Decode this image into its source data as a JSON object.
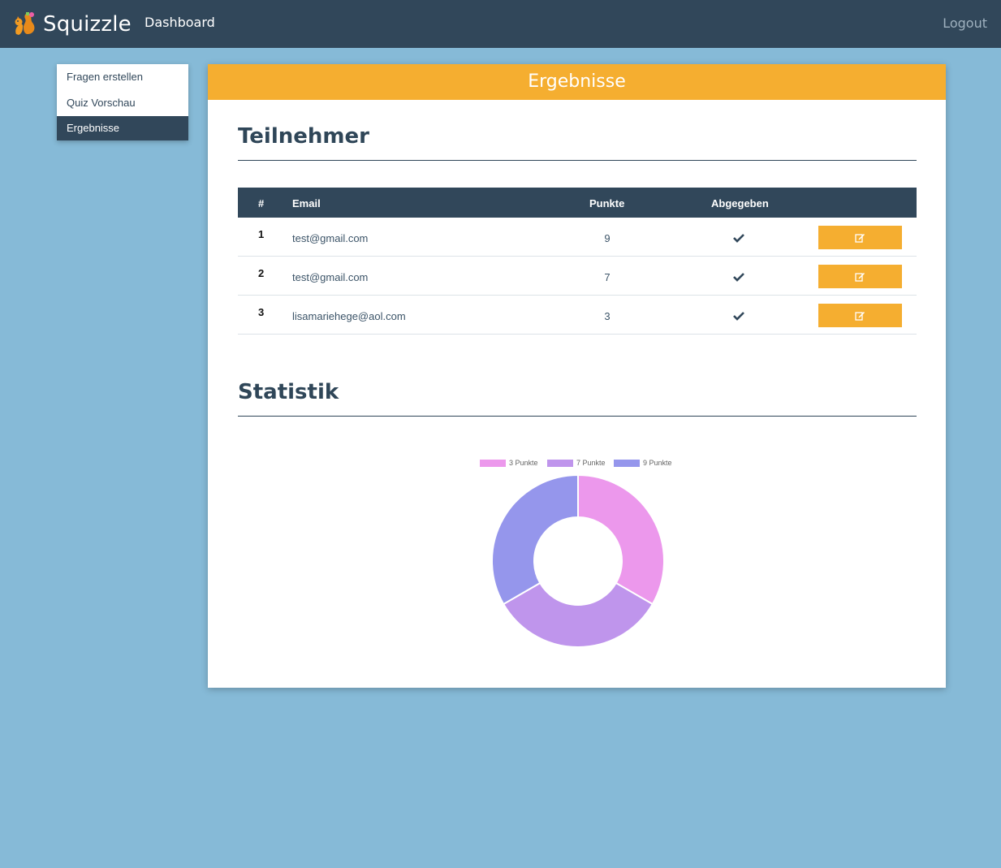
{
  "nav": {
    "brand": "Squizzle",
    "dashboard": "Dashboard",
    "logout": "Logout"
  },
  "sidebar": {
    "items": [
      {
        "label": "Fragen erstellen"
      },
      {
        "label": "Quiz Vorschau"
      },
      {
        "label": "Ergebnisse"
      }
    ]
  },
  "panel": {
    "header": "Ergebnisse",
    "participants_title": "Teilnehmer",
    "stats_title": "Statistik"
  },
  "table": {
    "headers": [
      "#",
      "Email",
      "Punkte",
      "Abgegeben"
    ],
    "rows": [
      {
        "num": "1",
        "email": "test@gmail.com",
        "points": "9"
      },
      {
        "num": "2",
        "email": "test@gmail.com",
        "points": "7"
      },
      {
        "num": "3",
        "email": "lisamariehege@aol.com",
        "points": "3"
      }
    ]
  },
  "colors": {
    "topbar": "#31475a",
    "accent": "#f5ae30",
    "background": "#86bad7"
  },
  "chart_data": {
    "type": "pie",
    "variant": "doughnut",
    "legend_position": "top",
    "categories": [
      "3 Punkte",
      "7 Punkte",
      "9 Punkte"
    ],
    "values": [
      1,
      1,
      1
    ],
    "colors": [
      "#ec98ec",
      "#bf95ec",
      "#9596ec"
    ]
  }
}
